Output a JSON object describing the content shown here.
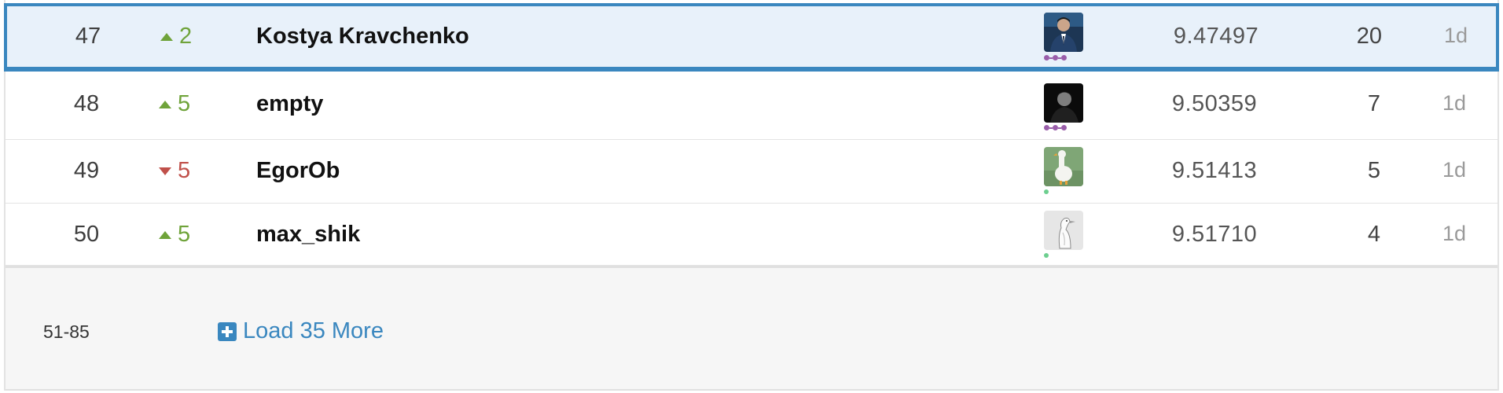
{
  "rows": [
    {
      "rank": "47",
      "change_direction": "up",
      "change_value": "2",
      "team_name": "Kostya Kravchenko",
      "avatar": "portrait-dark-suit",
      "tier": "purple-three-dots",
      "score": "9.47497",
      "entries": "20",
      "last": "1d",
      "highlighted": true
    },
    {
      "rank": "48",
      "change_direction": "up",
      "change_value": "5",
      "team_name": "empty",
      "avatar": "portrait-dark",
      "tier": "purple-three-dots",
      "score": "9.50359",
      "entries": "7",
      "last": "1d"
    },
    {
      "rank": "49",
      "change_direction": "down",
      "change_value": "5",
      "team_name": "EgorOb",
      "avatar": "goose-green",
      "tier": "green-dot",
      "score": "9.51413",
      "entries": "5",
      "last": "1d"
    },
    {
      "rank": "50",
      "change_direction": "up",
      "change_value": "5",
      "team_name": "max_shik",
      "avatar": "goose-sketch",
      "tier": "green-dot",
      "score": "9.51710",
      "entries": "4",
      "last": "1d"
    }
  ],
  "footer": {
    "range": "51-85",
    "load_more_label": "Load 35 More"
  },
  "colors": {
    "accent": "#3a87bf",
    "highlight_bg": "#e8f1fa",
    "up": "#6fa33a",
    "down": "#c0504a",
    "tier_purple": "#9a5eaa",
    "tier_green": "#6dcf8f"
  }
}
